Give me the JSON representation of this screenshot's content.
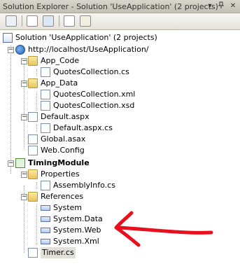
{
  "window": {
    "title": "Solution Explorer - Solution 'UseApplication' (2 projects)",
    "buttons": [
      "▾",
      "📌",
      "✕"
    ]
  },
  "toolbar": {
    "items": [
      "properties",
      "show-all-files",
      "refresh",
      "view-code",
      "copy-website"
    ]
  },
  "tree": {
    "solution": "Solution 'UseApplication' (2 projects)",
    "website": "http://localhost/UseApplication/",
    "app_code": "App_Code",
    "quotes_cs": "QuotesCollection.cs",
    "app_data": "App_Data",
    "quotes_xml": "QuotesCollection.xml",
    "quotes_xsd": "QuotesCollection.xsd",
    "default_aspx": "Default.aspx",
    "default_aspx_cs": "Default.aspx.cs",
    "global_asax": "Global.asax",
    "web_config": "Web.Config",
    "timing_module": "TimingModule",
    "properties": "Properties",
    "assembly_info": "AssemblyInfo.cs",
    "references": "References",
    "ref_system": "System",
    "ref_system_data": "System.Data",
    "ref_system_web": "System.Web",
    "ref_system_xml": "System.Xml",
    "timer_cs": "Timer.cs"
  },
  "annotation": {
    "color": "#e8101c",
    "points_to": "System.Web"
  }
}
